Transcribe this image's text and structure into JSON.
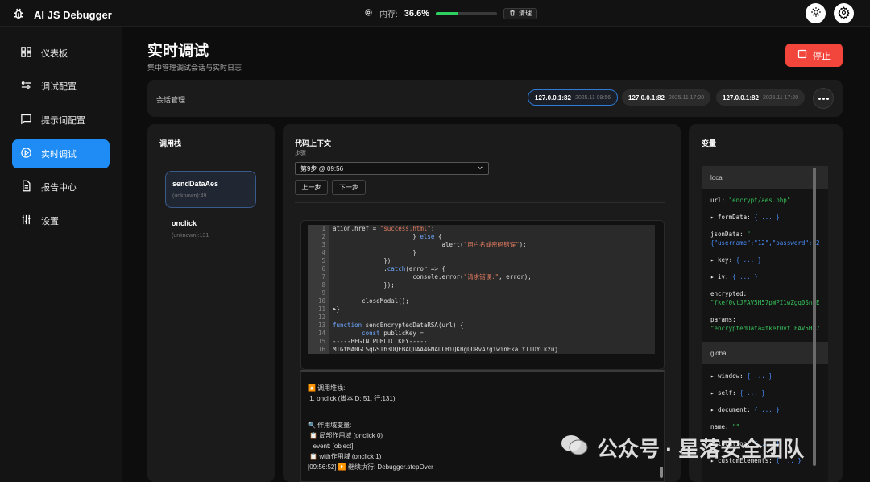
{
  "app": {
    "title": "AI JS Debugger"
  },
  "memory": {
    "label": "内存:",
    "value": "36.6%",
    "percent": 36.6,
    "clear_label": "清理"
  },
  "sidebar": {
    "items": [
      {
        "label": "仪表板",
        "icon": "dashboard-icon"
      },
      {
        "label": "调试配置",
        "icon": "sliders-icon"
      },
      {
        "label": "提示词配置",
        "icon": "message-icon"
      },
      {
        "label": "实时调试",
        "icon": "play-circle-icon",
        "active": true
      },
      {
        "label": "报告中心",
        "icon": "document-icon"
      },
      {
        "label": "设置",
        "icon": "equalizer-icon"
      }
    ]
  },
  "header": {
    "title": "实时调试",
    "subtitle": "集中管理调试会话与实时日志",
    "stop_label": "停止"
  },
  "sessions": {
    "label": "会话管理",
    "items": [
      {
        "host": "127.0.0.1:82",
        "time": "2025.11 09:56",
        "active": true
      },
      {
        "host": "127.0.0.1:82",
        "time": "2025.11 17:20"
      },
      {
        "host": "127.0.0.1:82",
        "time": "2025.11 17:20"
      }
    ]
  },
  "callstack": {
    "title": "调用栈",
    "frames": [
      {
        "fn": "sendDataAes",
        "loc": "(unknown):49",
        "active": true
      },
      {
        "fn": "onclick",
        "loc": "(unknown):131"
      }
    ]
  },
  "context": {
    "title": "代码上下文",
    "step_label": "步骤",
    "step_value": "第9步 @ 09:56",
    "prev_label": "上一步",
    "next_label": "下一步",
    "code_lines": [
      {
        "n": "1",
        "t": "ation.href = \"success.html\";"
      },
      {
        "n": "2",
        "t": "                      } else {"
      },
      {
        "n": "3",
        "t": "                              alert(\"用户名或密码错误\");"
      },
      {
        "n": "4",
        "t": "                      }"
      },
      {
        "n": "5",
        "t": "              })"
      },
      {
        "n": "6",
        "t": "              .catch(error => {"
      },
      {
        "n": "7",
        "t": "                      console.error(\"请求错误:\", error);"
      },
      {
        "n": "8",
        "t": "              });"
      },
      {
        "n": "9",
        "t": ""
      },
      {
        "n": "10",
        "t": "        closeModal();"
      },
      {
        "n": "11",
        "t": "➤}"
      },
      {
        "n": "12",
        "t": ""
      },
      {
        "n": "13",
        "t": "function sendEncryptedDataRSA(url) {"
      },
      {
        "n": "14",
        "t": "        const publicKey = `"
      },
      {
        "n": "15",
        "t": "-----BEGIN PUBLIC KEY-----"
      },
      {
        "n": "16",
        "t": "MIGfMA0GCSqGSIb3DQEBAQUAA4GNADCBiQKBgQDRvA7giwinEkaTYllDYCkzuj"
      }
    ],
    "console": [
      "",
      "🔼 调用堆栈:",
      " 1. onclick (脚本ID: 51, 行:131)",
      "",
      "🔍 作用域变量:",
      " 📋 局部作用域 (onclick 0)",
      "   event: [object]",
      " 📋 with作用域 (onclick 1)",
      "[09:56:52] ▶️ 继续执行: Debugger.stepOver"
    ]
  },
  "variables": {
    "title": "变量",
    "local_label": "local",
    "global_label": "global",
    "local": [
      {
        "k": "url: ",
        "v": "\"encrypt/aes.php\""
      },
      {
        "k": "▸ formData: ",
        "v": "{ ... }"
      },
      {
        "k": "jsonData: ",
        "v": "\""
      },
      {
        "k": "",
        "v": "{\"username\":\"12\",\"password\":\"2"
      },
      {
        "k": "▸ key: ",
        "v": "{ ... }"
      },
      {
        "k": "▸ iv: ",
        "v": "{ ... }"
      },
      {
        "k": "encrypted:",
        "v": ""
      },
      {
        "k": "",
        "v": "\"fkef0vtJFAV5H57pWPI1wZgq0SnoE"
      },
      {
        "k": "params:",
        "v": ""
      },
      {
        "k": "",
        "v": "\"encryptedData=fkef0vtJFAV5H57"
      }
    ],
    "global": [
      {
        "k": "▸ window: ",
        "v": "{ ... }"
      },
      {
        "k": "▸ self: ",
        "v": "{ ... }"
      },
      {
        "k": "▸ document: ",
        "v": "{ ... }"
      },
      {
        "k": "name: ",
        "v": "\"\""
      },
      {
        "k": "▸ location: ",
        "v": "{ ... }"
      },
      {
        "k": "▸ customElements: ",
        "v": "{ ... }"
      }
    ]
  },
  "watermark": {
    "text": "公众号 · 星落安全团队"
  }
}
